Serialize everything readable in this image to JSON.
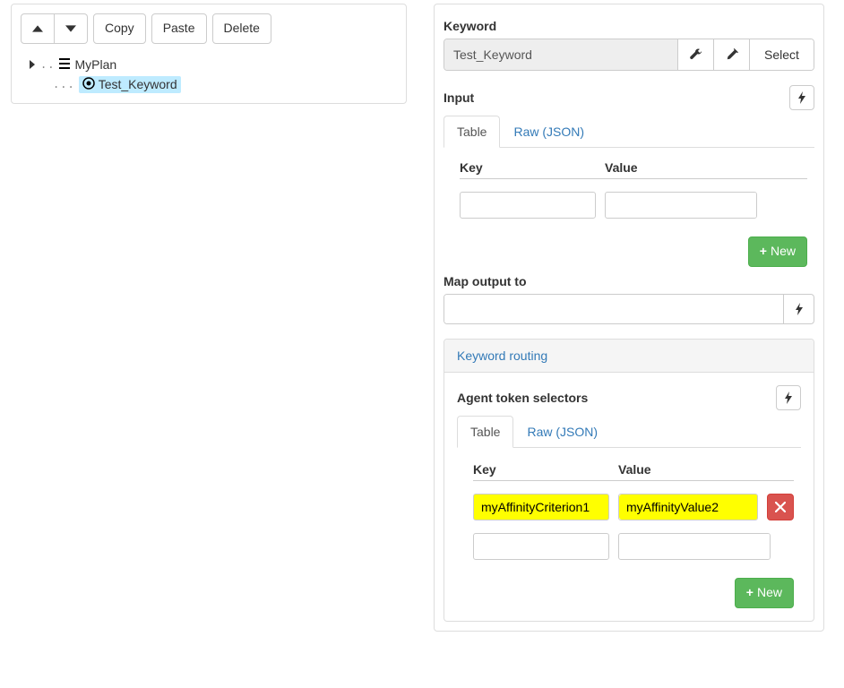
{
  "toolbar": {
    "copy": "Copy",
    "paste": "Paste",
    "delete": "Delete"
  },
  "tree": {
    "root_label": "MyPlan",
    "child_label": "Test_Keyword"
  },
  "keyword": {
    "section_label": "Keyword",
    "value": "Test_Keyword",
    "select_label": "Select"
  },
  "input": {
    "section_label": "Input",
    "tab_table": "Table",
    "tab_raw": "Raw (JSON)",
    "key_header": "Key",
    "value_header": "Value",
    "rows": [
      {
        "key": "",
        "value": ""
      }
    ],
    "new_label": "New"
  },
  "map_output": {
    "section_label": "Map output to",
    "value": ""
  },
  "routing": {
    "header": "Keyword routing",
    "agent_section_label": "Agent token selectors",
    "tab_table": "Table",
    "tab_raw": "Raw (JSON)",
    "key_header": "Key",
    "value_header": "Value",
    "rows": [
      {
        "key": "myAffinityCriterion1",
        "value": "myAffinityValue2",
        "highlight": true,
        "deletable": true
      },
      {
        "key": "",
        "value": "",
        "highlight": false,
        "deletable": false
      }
    ],
    "new_label": "New"
  }
}
